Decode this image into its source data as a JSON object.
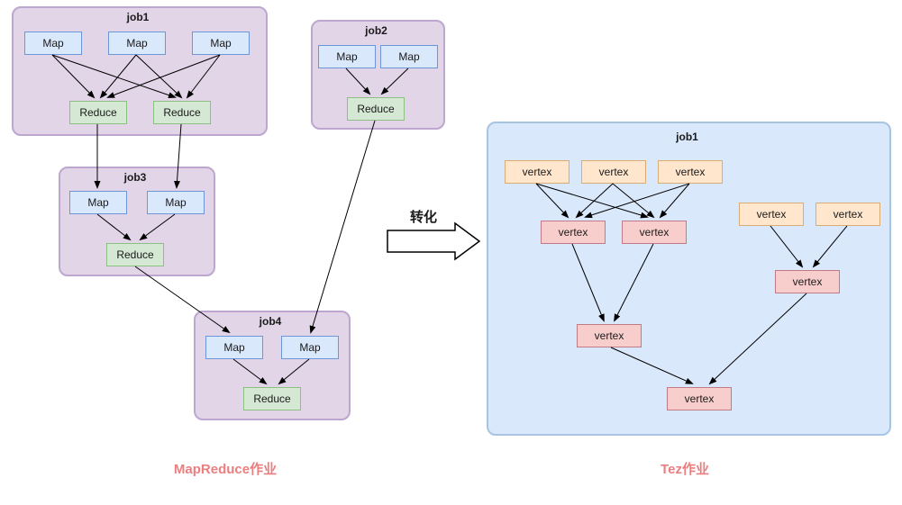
{
  "labels": {
    "map": "Map",
    "reduce": "Reduce",
    "vertex": "vertex",
    "job1": "job1",
    "job2": "job2",
    "job3": "job3",
    "job4": "job4",
    "tez_job": "job1",
    "transform": "转化",
    "caption_left": "MapReduce作业",
    "caption_right": "Tez作业"
  },
  "chart_data": {
    "type": "diagram",
    "title": "MapReduce to Tez conversion",
    "left": {
      "label": "MapReduce作业",
      "jobs": [
        {
          "id": "job1",
          "maps": 3,
          "reduces": 2,
          "edges_to": [
            "job3"
          ]
        },
        {
          "id": "job2",
          "maps": 2,
          "reduces": 1,
          "edges_to": [
            "job4"
          ]
        },
        {
          "id": "job3",
          "maps": 2,
          "reduces": 1,
          "edges_to": [
            "job4"
          ]
        },
        {
          "id": "job4",
          "maps": 2,
          "reduces": 1,
          "edges_to": []
        }
      ],
      "intra_job_edges": {
        "job1": "all-maps→all-reduces",
        "job2": "all-maps→reduce",
        "job3": "all-maps→reduce",
        "job4": "all-maps→reduce"
      }
    },
    "transform_label": "转化",
    "right": {
      "label": "Tez作业",
      "container": "job1",
      "vertices": {
        "orange_top_left_group": 3,
        "orange_top_right_group": 2,
        "pink_mid_left_pair": 2,
        "pink_right_mid": 1,
        "pink_lower_left": 1,
        "pink_bottom": 1
      },
      "edges": [
        "3_orange_top_left → 2_pink_mid_left (full crossbar)",
        "2_pink_mid_left → pink_lower_left",
        "2_orange_top_right → pink_right_mid",
        "pink_lower_left → pink_bottom",
        "pink_right_mid → pink_bottom"
      ]
    }
  }
}
